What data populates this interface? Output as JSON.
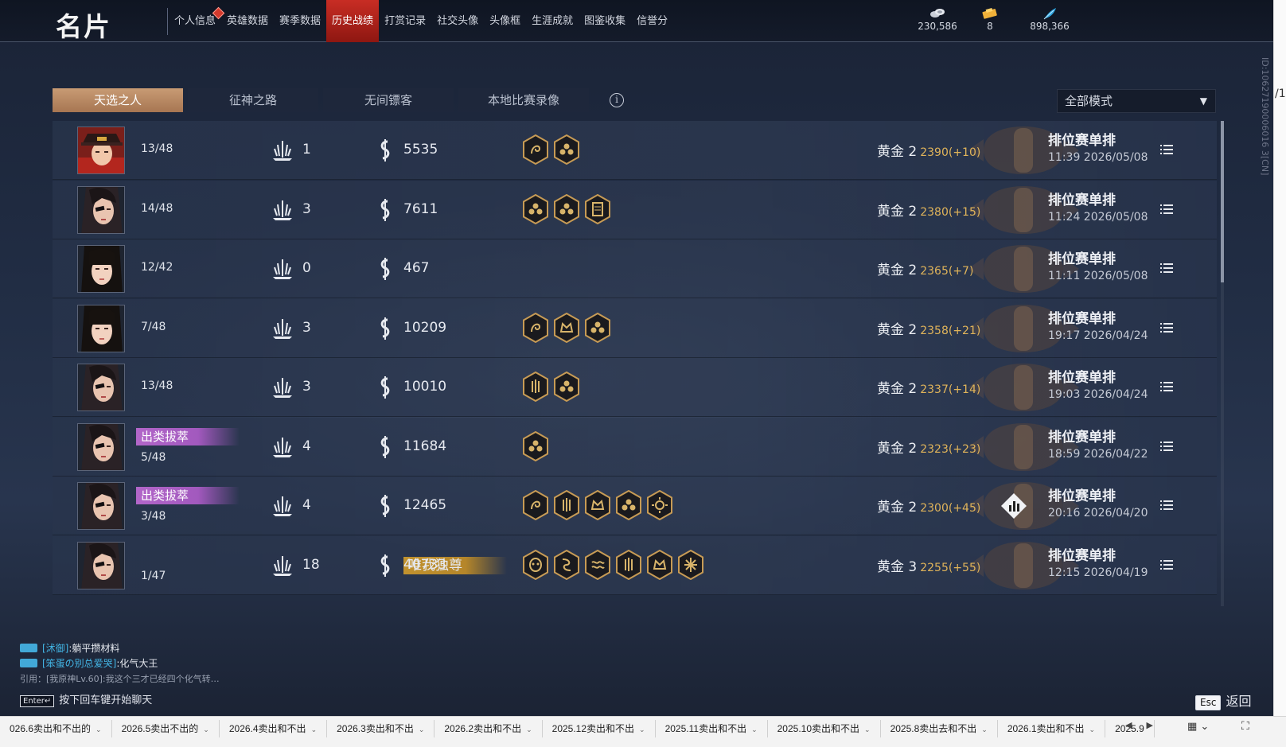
{
  "header": {
    "title": "名片",
    "nav": [
      {
        "label": "个人信息",
        "badge": true
      },
      {
        "label": "英雄数据"
      },
      {
        "label": "赛季数据"
      },
      {
        "label": "历史战绩",
        "active": true
      },
      {
        "label": "打赏记录"
      },
      {
        "label": "社交头像"
      },
      {
        "label": "头像框"
      },
      {
        "label": "生涯成就"
      },
      {
        "label": "图鉴收集"
      },
      {
        "label": "信誉分"
      }
    ],
    "currencies": [
      {
        "icon": "coin-pile-icon",
        "value": "230,586"
      },
      {
        "icon": "ticket-icon",
        "value": "8"
      },
      {
        "icon": "feather-icon",
        "value": "898,366"
      }
    ]
  },
  "tabs": [
    {
      "label": "天选之人",
      "active": true
    },
    {
      "label": "征神之路"
    },
    {
      "label": "无间镖客"
    },
    {
      "label": "本地比赛录像"
    }
  ],
  "mode_filter": {
    "value": "全部模式"
  },
  "matches": [
    {
      "avatar": "red-hat-hero",
      "title": "",
      "rank": "13/48",
      "kills": "1",
      "gold": "5535",
      "medals": [
        "dragon",
        "flower"
      ],
      "tier": "黄金 2",
      "score": "2390(+10)",
      "mode": "排位赛单排",
      "time": "11:39  2026/05/08"
    },
    {
      "avatar": "eyepatch-hero",
      "title": "",
      "rank": "14/48",
      "kills": "3",
      "gold": "7611",
      "medals": [
        "flower",
        "flower",
        "scroll"
      ],
      "tier": "黄金 2",
      "score": "2380(+15)",
      "mode": "排位赛单排",
      "time": "11:24  2026/05/08"
    },
    {
      "avatar": "bangs-hero",
      "title": "",
      "rank": "12/42",
      "kills": "0",
      "gold": "467",
      "medals": [],
      "tier": "黄金 2",
      "score": "2365(+7)",
      "mode": "排位赛单排",
      "time": "11:11  2026/05/08"
    },
    {
      "avatar": "bangs-hero",
      "title": "",
      "rank": "7/48",
      "kills": "3",
      "gold": "10209",
      "medals": [
        "dragon",
        "crown",
        "flower"
      ],
      "tier": "黄金 2",
      "score": "2358(+21)",
      "mode": "排位赛单排",
      "time": "19:17  2026/04/24"
    },
    {
      "avatar": "eyepatch-hero",
      "title": "",
      "rank": "13/48",
      "kills": "3",
      "gold": "10010",
      "medals": [
        "claw",
        "flower"
      ],
      "tier": "黄金 2",
      "score": "2337(+14)",
      "mode": "排位赛单排",
      "time": "19:03  2026/04/24"
    },
    {
      "avatar": "eyepatch-hero",
      "title": "出类拔萃",
      "title_color": "purple",
      "rank": "5/48",
      "kills": "4",
      "gold": "11684",
      "medals": [
        "flower"
      ],
      "tier": "黄金 2",
      "score": "2323(+23)",
      "mode": "排位赛单排",
      "time": "18:59  2026/04/22"
    },
    {
      "avatar": "eyepatch-hero",
      "title": "出类拔萃",
      "title_color": "purple",
      "rank": "3/48",
      "kills": "4",
      "gold": "12465",
      "medals": [
        "dragon",
        "claw",
        "crown",
        "flower",
        "sun"
      ],
      "tier": "黄金 2",
      "score": "2300(+45)",
      "mode": "排位赛单排",
      "time": "20:16  2026/04/20",
      "stats_button": true
    },
    {
      "avatar": "eyepatch-hero",
      "title": "唯我独尊",
      "title_color": "gold",
      "rank": "1/47",
      "kills": "18",
      "gold": "40733",
      "medals": [
        "mask",
        "serpent",
        "wave",
        "claw",
        "crown",
        "star"
      ],
      "tier": "黄金 3",
      "score": "2255(+55)",
      "mode": "排位赛单排",
      "time": "12:15  2026/04/19"
    }
  ],
  "chat": {
    "lines": [
      {
        "name": "[沭御]",
        "msg": ":躺平攒材料"
      },
      {
        "name": "[笨蛋の别总爱哭]",
        "msg": ":化气大王"
      }
    ],
    "quote": "引用：[我原神Lv.60]:我这个三才已经四个化气转…",
    "hint_key": "Enter↵",
    "hint": "按下回车键开始聊天"
  },
  "esc": {
    "key": "Esc",
    "label": "返回"
  },
  "player_id": "ID:10627190006016 3[CN]",
  "edge_text": "/1",
  "sheet_tabs": [
    "026.6卖出和不出的",
    "2026.5卖出不出的",
    "2026.4卖出和不出",
    "2026.3卖出和不出",
    "2026.2卖出和不出",
    "2025.12卖出和不出",
    "2025.11卖出和不出",
    "2025.10卖出和不出",
    "2025.8卖出去和不出",
    "2026.1卖出和不出",
    "2025.9"
  ],
  "colors": {
    "accent_red": "#c82d24",
    "tab_active": "#b8875f",
    "score_gold": "#e0b45a",
    "title_purple": "#b266c9",
    "title_gold": "#c1922e",
    "chat_name": "#43b6e6"
  }
}
